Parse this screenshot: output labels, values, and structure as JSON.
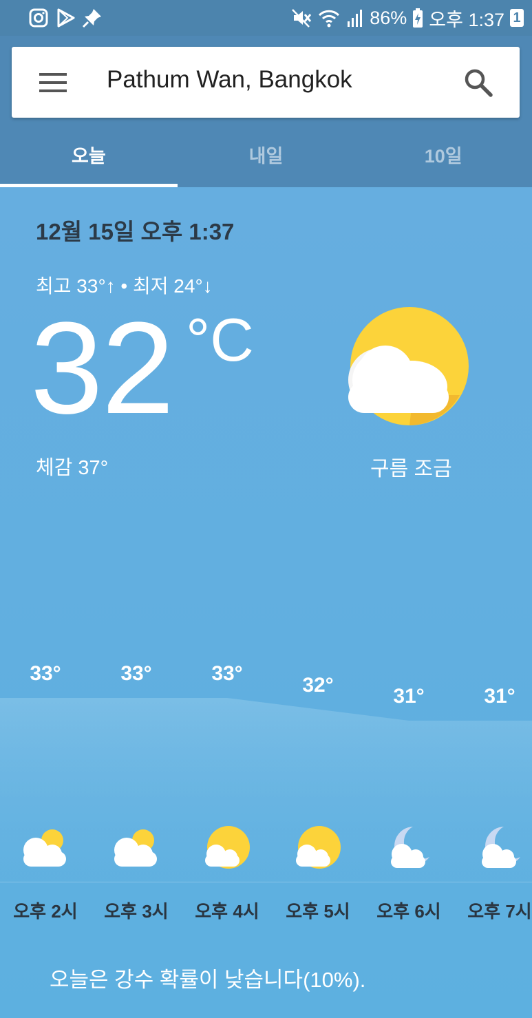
{
  "status_bar": {
    "battery": "86%",
    "time": "오후 1:37",
    "notification_count": "1",
    "left_icons": [
      "instagram-icon",
      "play-store-icon",
      "pin-icon"
    ],
    "right_icons": [
      "mute-icon",
      "wifi-icon",
      "signal-icon",
      "battery-charging-icon"
    ]
  },
  "search": {
    "location": "Pathum Wan, Bangkok"
  },
  "tabs": [
    {
      "label": "오늘",
      "active": true
    },
    {
      "label": "내일",
      "active": false
    },
    {
      "label": "10일",
      "active": false
    }
  ],
  "current": {
    "date": "12월 15일 오후 1:37",
    "hi_lo": "최고 33°↑ • 최저 24°↓",
    "temperature": "32",
    "unit": "°C",
    "feels_like": "체감 37°",
    "condition": "구름 조금",
    "condition_icon": "partly-cloudy-icon"
  },
  "hourly": [
    {
      "label": "오후 2시",
      "temp": "33°",
      "temp_value": 33,
      "icon": "cloud-sun-icon"
    },
    {
      "label": "오후 3시",
      "temp": "33°",
      "temp_value": 33,
      "icon": "cloud-sun-icon"
    },
    {
      "label": "오후 4시",
      "temp": "33°",
      "temp_value": 33,
      "icon": "sun-cloud-icon"
    },
    {
      "label": "오후 5시",
      "temp": "32°",
      "temp_value": 32,
      "icon": "sun-cloud-icon"
    },
    {
      "label": "오후 6시",
      "temp": "31°",
      "temp_value": 31,
      "icon": "moon-cloud-icon"
    },
    {
      "label": "오후 7시",
      "temp": "31°",
      "temp_value": 31,
      "icon": "moon-cloud-icon"
    }
  ],
  "precipitation": "오늘은 강수 확률이 낮습니다(10%).",
  "colors": {
    "header": "#4f88b5",
    "background": "#5fafe0",
    "sun": "#fcd33a"
  }
}
